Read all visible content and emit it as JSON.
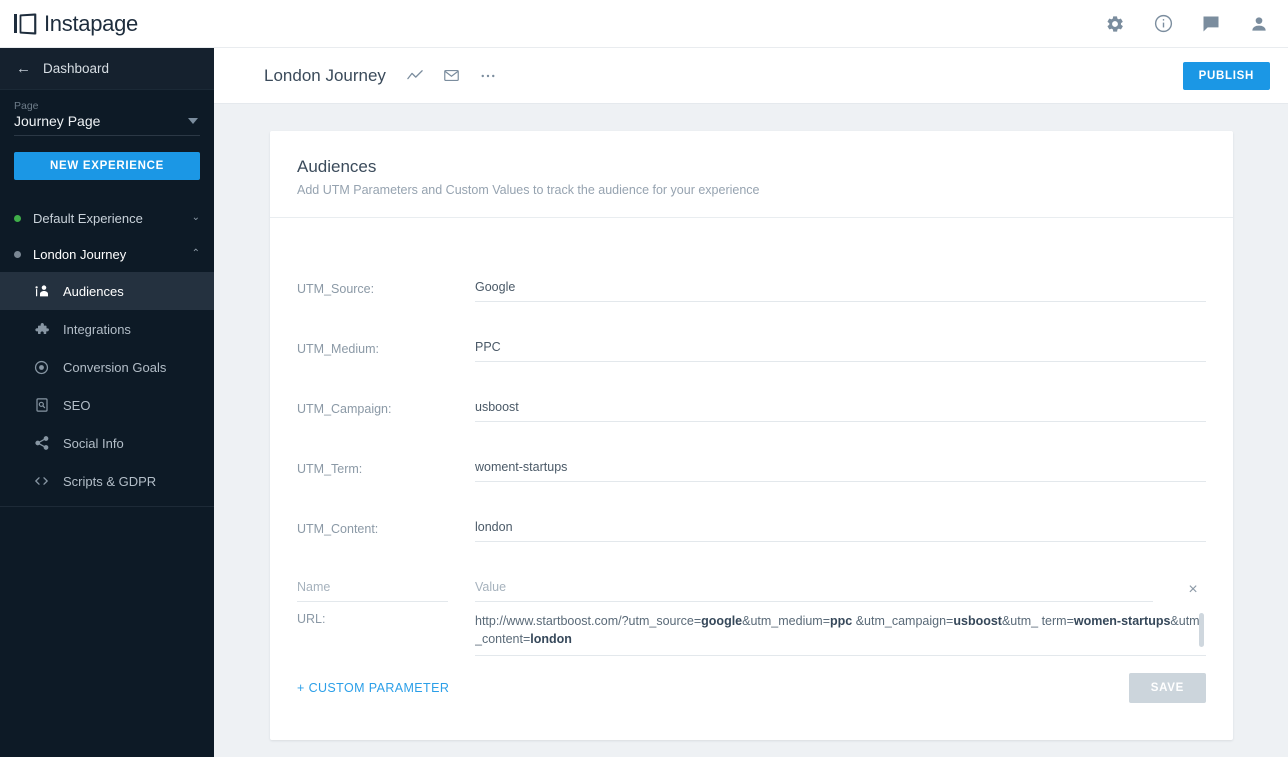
{
  "topbar": {
    "brand": "Instapage",
    "icons": [
      {
        "name": "settings-gear-icon",
        "label": "Settings"
      },
      {
        "name": "info-circle-icon",
        "label": "Info"
      },
      {
        "name": "chat-message-icon",
        "label": "Messages"
      },
      {
        "name": "user-account-icon",
        "label": "Account"
      }
    ]
  },
  "sidebar": {
    "dashboard": "Dashboard",
    "back_arrow": "←",
    "page_label": "Page",
    "page_value": "Journey Page",
    "new_experience": "NEW EXPERIENCE",
    "experiences": [
      {
        "label": "Default Experience",
        "dot": "green",
        "chevron": "⌄"
      },
      {
        "label": "London Journey",
        "dot": "gray",
        "chevron": "⌃"
      }
    ],
    "items": [
      {
        "label": "Audiences",
        "icon": "audience-icon",
        "active": true
      },
      {
        "label": "Integrations",
        "icon": "puzzle-icon",
        "active": false
      },
      {
        "label": "Conversion Goals",
        "icon": "target-icon",
        "active": false
      },
      {
        "label": "SEO",
        "icon": "seo-document-icon",
        "active": false
      },
      {
        "label": "Social Info",
        "icon": "share-icon",
        "active": false
      },
      {
        "label": "Scripts & GDPR",
        "icon": "code-brackets-icon",
        "active": false
      }
    ]
  },
  "page_header": {
    "title": "London Journey",
    "icons": [
      {
        "name": "analytics-chart-icon"
      },
      {
        "name": "envelope-icon"
      },
      {
        "name": "more-options-icon"
      }
    ],
    "publish_label": "PUBLISH"
  },
  "card": {
    "title": "Audiences",
    "subtitle": "Add UTM Parameters and Custom Values to track the audience for your experience",
    "fields": [
      {
        "label": "UTM_Source:",
        "value": "Google",
        "placeholder": ""
      },
      {
        "label": "UTM_Medium:",
        "value": "PPC",
        "placeholder": ""
      },
      {
        "label": "UTM_Campaign:",
        "value": "usboost",
        "placeholder": ""
      },
      {
        "label": "UTM_Term:",
        "value": "woment-startups",
        "placeholder": ""
      },
      {
        "label": "UTM_Content:",
        "value": "london",
        "placeholder": ""
      }
    ],
    "custom_row": {
      "name_placeholder": "Name",
      "name_value": "",
      "value_placeholder": "Value",
      "value_value": "",
      "remove_label": "×"
    },
    "url": {
      "label": "URL:",
      "segments": [
        {
          "text": "http://www.startboost.com/?utm_source=",
          "bold": false
        },
        {
          "text": "google",
          "bold": true
        },
        {
          "text": "&utm_medium=",
          "bold": false
        },
        {
          "text": "ppc",
          "bold": true
        },
        {
          "text": " &utm_campaign=",
          "bold": false
        },
        {
          "text": "usboost",
          "bold": true
        },
        {
          "text": "&utm_ term=",
          "bold": false
        },
        {
          "text": "women-startups",
          "bold": true
        },
        {
          "text": "&utm_content=",
          "bold": false
        },
        {
          "text": "london",
          "bold": true
        }
      ]
    },
    "add_parameter_label": "+ CUSTOM PARAMETER",
    "save_label": "SAVE"
  },
  "colors": {
    "accent_blue": "#1b97e5",
    "sidebar_bg": "#0d1a26",
    "sidebar_active": "#24313f",
    "content_bg": "#eef1f4",
    "status_green": "#3fae49",
    "status_gray": "#7a8794",
    "save_disabled": "#ccd5dc"
  }
}
